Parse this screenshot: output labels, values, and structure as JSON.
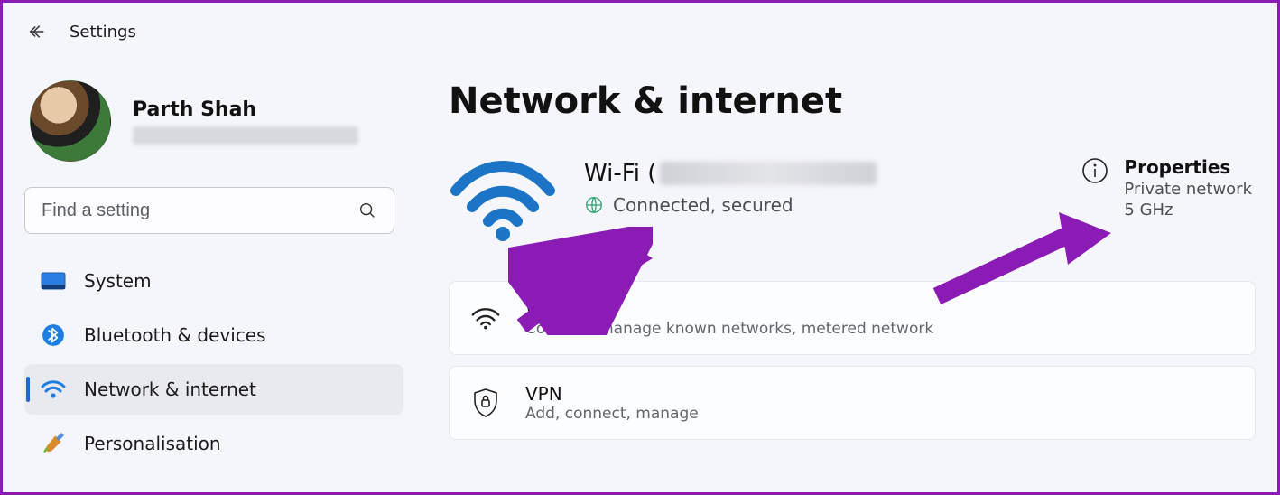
{
  "app": {
    "title": "Settings"
  },
  "user": {
    "name": "Parth Shah"
  },
  "search": {
    "placeholder": "Find a setting"
  },
  "sidebar": {
    "items": [
      {
        "label": "System"
      },
      {
        "label": "Bluetooth & devices"
      },
      {
        "label": "Network & internet"
      },
      {
        "label": "Personalisation"
      }
    ],
    "active_index": 2
  },
  "page": {
    "title": "Network & internet"
  },
  "status": {
    "label_prefix": "Wi-Fi (",
    "sub": "Connected, secured"
  },
  "properties": {
    "title": "Properties",
    "line1": "Private network",
    "line2": "5 GHz"
  },
  "cards": [
    {
      "title": "WiFi",
      "sub": "Connect, manage known networks, metered network"
    },
    {
      "title": "VPN",
      "sub": "Add, connect, manage"
    }
  ],
  "colors": {
    "accent": "#1f66d0",
    "annotation": "#8a1bb5"
  }
}
